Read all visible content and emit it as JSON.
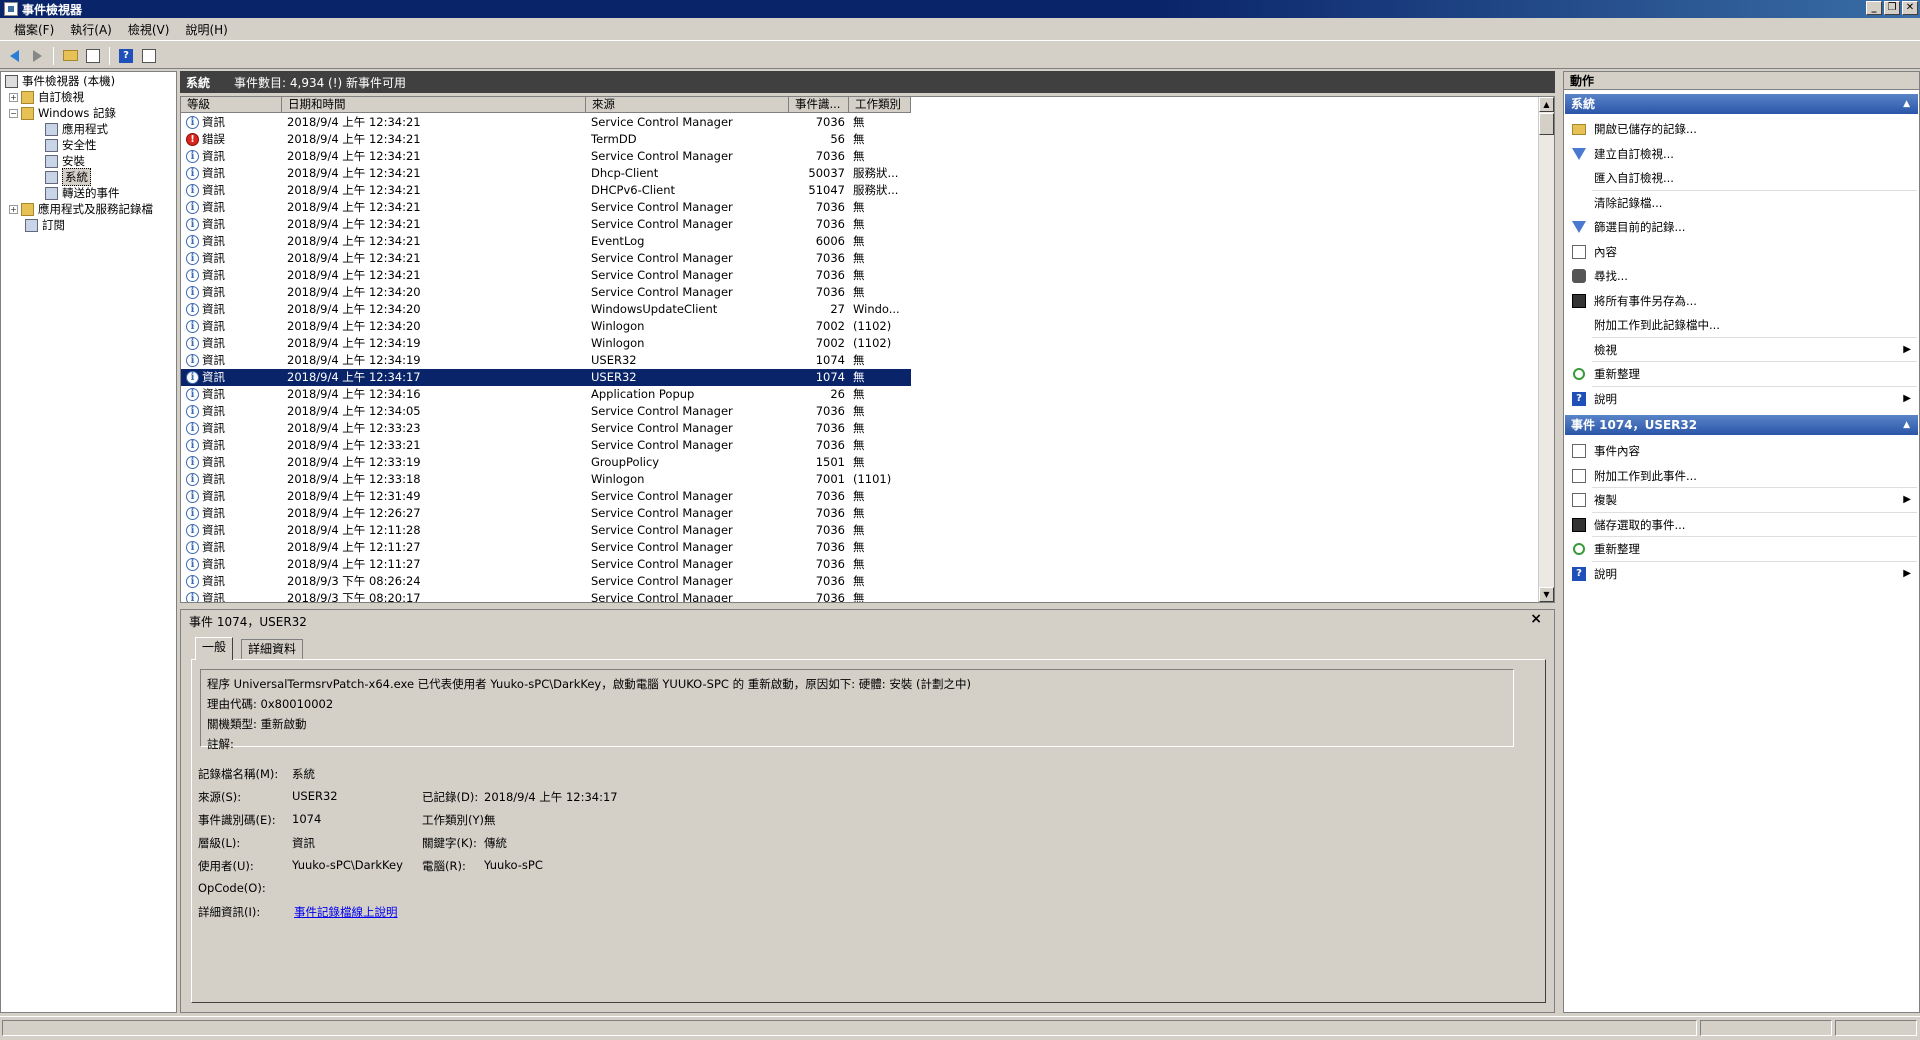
{
  "window": {
    "title": "事件檢視器"
  },
  "menu": [
    "檔案(F)",
    "執行(A)",
    "檢視(V)",
    "說明(H)"
  ],
  "tree": {
    "root": "事件檢視器 (本機)",
    "custom_views": "自訂檢視",
    "windows_logs": "Windows 記錄",
    "logs": [
      "應用程式",
      "安全性",
      "安裝",
      "系統",
      "轉送的事件"
    ],
    "app_service_logs": "應用程式及服務記錄檔",
    "subscriptions": "訂閱"
  },
  "center": {
    "log_name": "系統",
    "event_count": "事件數目: 4,934 (!) 新事件可用"
  },
  "columns": [
    "等級",
    "日期和時間",
    "來源",
    "事件識...",
    "工作類別"
  ],
  "events": [
    {
      "level": "資訊",
      "type": "info",
      "date": "2018/9/4 上午 12:34:21",
      "source": "Service Control Manager",
      "id": "7036",
      "task": "無"
    },
    {
      "level": "錯誤",
      "type": "error",
      "date": "2018/9/4 上午 12:34:21",
      "source": "TermDD",
      "id": "56",
      "task": "無"
    },
    {
      "level": "資訊",
      "type": "info",
      "date": "2018/9/4 上午 12:34:21",
      "source": "Service Control Manager",
      "id": "7036",
      "task": "無"
    },
    {
      "level": "資訊",
      "type": "info",
      "date": "2018/9/4 上午 12:34:21",
      "source": "Dhcp-Client",
      "id": "50037",
      "task": "服務狀..."
    },
    {
      "level": "資訊",
      "type": "info",
      "date": "2018/9/4 上午 12:34:21",
      "source": "DHCPv6-Client",
      "id": "51047",
      "task": "服務狀..."
    },
    {
      "level": "資訊",
      "type": "info",
      "date": "2018/9/4 上午 12:34:21",
      "source": "Service Control Manager",
      "id": "7036",
      "task": "無"
    },
    {
      "level": "資訊",
      "type": "info",
      "date": "2018/9/4 上午 12:34:21",
      "source": "Service Control Manager",
      "id": "7036",
      "task": "無"
    },
    {
      "level": "資訊",
      "type": "info",
      "date": "2018/9/4 上午 12:34:21",
      "source": "EventLog",
      "id": "6006",
      "task": "無"
    },
    {
      "level": "資訊",
      "type": "info",
      "date": "2018/9/4 上午 12:34:21",
      "source": "Service Control Manager",
      "id": "7036",
      "task": "無"
    },
    {
      "level": "資訊",
      "type": "info",
      "date": "2018/9/4 上午 12:34:21",
      "source": "Service Control Manager",
      "id": "7036",
      "task": "無"
    },
    {
      "level": "資訊",
      "type": "info",
      "date": "2018/9/4 上午 12:34:20",
      "source": "Service Control Manager",
      "id": "7036",
      "task": "無"
    },
    {
      "level": "資訊",
      "type": "info",
      "date": "2018/9/4 上午 12:34:20",
      "source": "WindowsUpdateClient",
      "id": "27",
      "task": "Windo..."
    },
    {
      "level": "資訊",
      "type": "info",
      "date": "2018/9/4 上午 12:34:20",
      "source": "Winlogon",
      "id": "7002",
      "task": "(1102)"
    },
    {
      "level": "資訊",
      "type": "info",
      "date": "2018/9/4 上午 12:34:19",
      "source": "Winlogon",
      "id": "7002",
      "task": "(1102)"
    },
    {
      "level": "資訊",
      "type": "info",
      "date": "2018/9/4 上午 12:34:19",
      "source": "USER32",
      "id": "1074",
      "task": "無"
    },
    {
      "level": "資訊",
      "type": "info",
      "date": "2018/9/4 上午 12:34:17",
      "source": "USER32",
      "id": "1074",
      "task": "無",
      "selected": true
    },
    {
      "level": "資訊",
      "type": "info",
      "date": "2018/9/4 上午 12:34:16",
      "source": "Application Popup",
      "id": "26",
      "task": "無"
    },
    {
      "level": "資訊",
      "type": "info",
      "date": "2018/9/4 上午 12:34:05",
      "source": "Service Control Manager",
      "id": "7036",
      "task": "無"
    },
    {
      "level": "資訊",
      "type": "info",
      "date": "2018/9/4 上午 12:33:23",
      "source": "Service Control Manager",
      "id": "7036",
      "task": "無"
    },
    {
      "level": "資訊",
      "type": "info",
      "date": "2018/9/4 上午 12:33:21",
      "source": "Service Control Manager",
      "id": "7036",
      "task": "無"
    },
    {
      "level": "資訊",
      "type": "info",
      "date": "2018/9/4 上午 12:33:19",
      "source": "GroupPolicy",
      "id": "1501",
      "task": "無"
    },
    {
      "level": "資訊",
      "type": "info",
      "date": "2018/9/4 上午 12:33:18",
      "source": "Winlogon",
      "id": "7001",
      "task": "(1101)"
    },
    {
      "level": "資訊",
      "type": "info",
      "date": "2018/9/4 上午 12:31:49",
      "source": "Service Control Manager",
      "id": "7036",
      "task": "無"
    },
    {
      "level": "資訊",
      "type": "info",
      "date": "2018/9/4 上午 12:26:27",
      "source": "Service Control Manager",
      "id": "7036",
      "task": "無"
    },
    {
      "level": "資訊",
      "type": "info",
      "date": "2018/9/4 上午 12:11:28",
      "source": "Service Control Manager",
      "id": "7036",
      "task": "無"
    },
    {
      "level": "資訊",
      "type": "info",
      "date": "2018/9/4 上午 12:11:27",
      "source": "Service Control Manager",
      "id": "7036",
      "task": "無"
    },
    {
      "level": "資訊",
      "type": "info",
      "date": "2018/9/4 上午 12:11:27",
      "source": "Service Control Manager",
      "id": "7036",
      "task": "無"
    },
    {
      "level": "資訊",
      "type": "info",
      "date": "2018/9/3 下午 08:26:24",
      "source": "Service Control Manager",
      "id": "7036",
      "task": "無"
    },
    {
      "level": "資訊",
      "type": "info",
      "date": "2018/9/3 下午 08:20:17",
      "source": "Service Control Manager",
      "id": "7036",
      "task": "無"
    }
  ],
  "detail": {
    "title": "事件 1074，USER32",
    "close": "×",
    "tabs": [
      "一般",
      "詳細資料"
    ],
    "message": [
      "程序 UniversalTermsrvPatch-x64.exe 已代表使用者 Yuuko-sPC\\DarkKey，啟動電腦 YUUKO-SPC 的 重新啟動，原因如下: 硬體: 安裝 (計劃之中)",
      "理由代碼: 0x80010002",
      "關機類型: 重新啟動",
      "註解:"
    ],
    "log_name_label": "記錄檔名稱(M):",
    "log_name": "系統",
    "source_label": "來源(S):",
    "source": "USER32",
    "logged_label": "已記錄(D):",
    "logged": "2018/9/4 上午 12:34:17",
    "event_id_label": "事件識別碼(E):",
    "event_id": "1074",
    "task_label": "工作類別(Y):",
    "task": "無",
    "level_label": "層級(L):",
    "level": "資訊",
    "keywords_label": "關鍵字(K):",
    "keywords": "傳統",
    "user_label": "使用者(U):",
    "user": "Yuuko-sPC\\DarkKey",
    "computer_label": "電腦(R):",
    "computer": "Yuuko-sPC",
    "opcode_label": "OpCode(O):",
    "more_info_label": "詳細資訊(I):",
    "more_info_link": "事件記錄檔線上說明"
  },
  "actions": {
    "header": "動作",
    "section1": "系統",
    "items1": [
      {
        "label": "開啟已儲存的記錄...",
        "icon": "open-folder-icon"
      },
      {
        "label": "建立自訂檢視...",
        "icon": "filter-icon"
      },
      {
        "label": "匯入自訂檢視...",
        "icon": ""
      },
      {
        "label": "清除記錄檔...",
        "icon": ""
      },
      {
        "label": "篩選目前的記錄...",
        "icon": "filter-icon"
      },
      {
        "label": "內容",
        "icon": "properties-icon"
      },
      {
        "label": "尋找...",
        "icon": "find-icon"
      },
      {
        "label": "將所有事件另存為...",
        "icon": "save-icon"
      },
      {
        "label": "附加工作到此記錄檔中...",
        "icon": ""
      },
      {
        "label": "檢視",
        "icon": "",
        "submenu": true
      },
      {
        "label": "重新整理",
        "icon": "refresh-icon"
      },
      {
        "label": "說明",
        "icon": "help-icon",
        "submenu": true
      }
    ],
    "section2": "事件 1074，USER32",
    "items2": [
      {
        "label": "事件內容",
        "icon": "properties-icon"
      },
      {
        "label": "附加工作到此事件...",
        "icon": "task-icon"
      },
      {
        "label": "複製",
        "icon": "copy-icon",
        "submenu": true
      },
      {
        "label": "儲存選取的事件...",
        "icon": "save-icon"
      },
      {
        "label": "重新整理",
        "icon": "refresh-icon"
      },
      {
        "label": "說明",
        "icon": "help-icon",
        "submenu": true
      }
    ]
  }
}
